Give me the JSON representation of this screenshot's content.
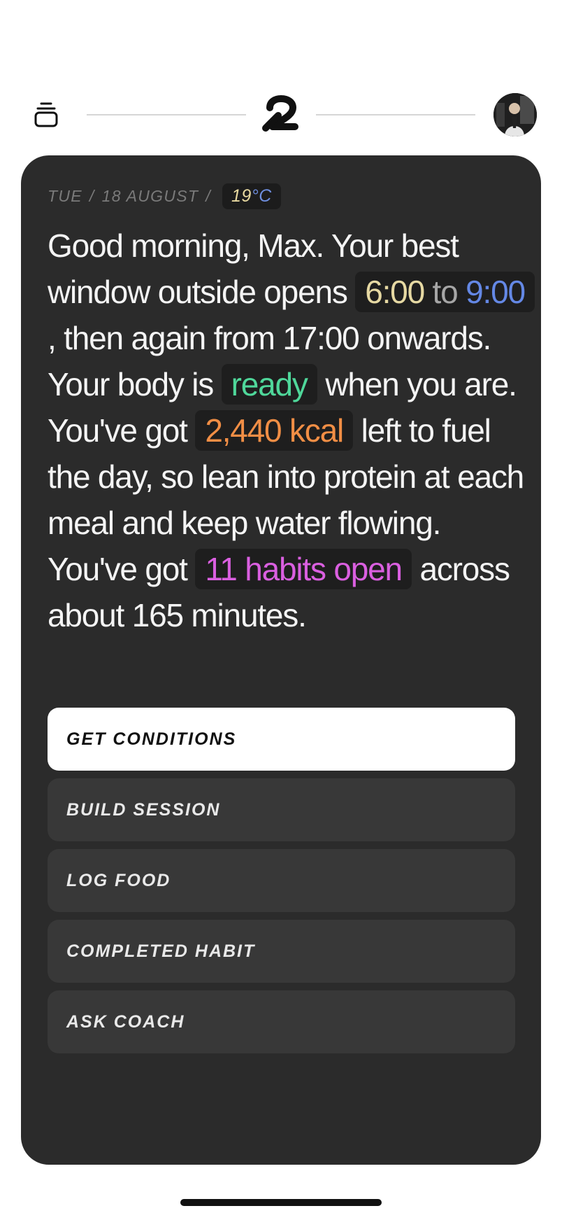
{
  "header": {
    "menu_icon": "stack-icon",
    "logo_icon": "brand-logo",
    "avatar_icon": "user-avatar"
  },
  "card": {
    "date": {
      "day": "TUE",
      "separator": "/",
      "date": "18 AUGUST",
      "temperature_value": "19",
      "temperature_unit": "°C"
    },
    "briefing": {
      "greeting": "Good morning, Max. Your best window outside opens ",
      "window_start": "6:00",
      "window_to": "to",
      "window_end": "9:00",
      "after_window": ", then again from 17:00 onwards. Your body is ",
      "readiness": "ready",
      "after_readiness": " when you are. You've got ",
      "calories": "2,440 kcal",
      "after_calories": " left to fuel the day, so lean into protein at each meal and keep water flowing. You've got ",
      "habits": "11 habits open",
      "after_habits": " across about 165 minutes."
    },
    "actions": [
      {
        "label": "GET CONDITIONS"
      },
      {
        "label": "BUILD SESSION"
      },
      {
        "label": "LOG FOOD"
      },
      {
        "label": "COMPLETED HABIT"
      },
      {
        "label": "ASK COACH"
      }
    ]
  },
  "colors": {
    "card_background": "#2b2b2b",
    "chip_background": "#1e1e1e",
    "time_start": "#e6d9a3",
    "time_end": "#6488e5",
    "ready": "#4fd79a",
    "calories": "#f18e45",
    "habits": "#da5fe0"
  }
}
